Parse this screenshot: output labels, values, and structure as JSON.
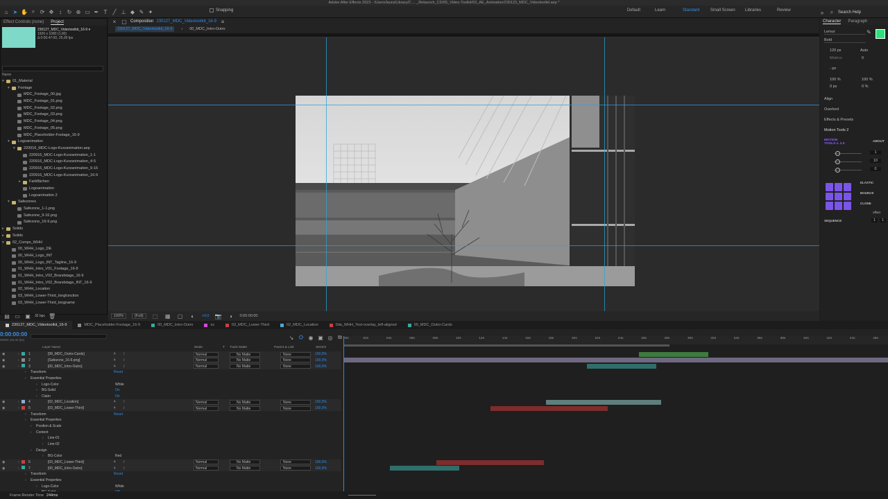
{
  "app": {
    "title": "Adobe After Effects 2023 - /Users/laura/Library/C ... _Relaunch_CD/05_Video-Toolkit/03_AE_Animation/230123_MDC_Videotoolkit.aep *"
  },
  "toolbar": {
    "snapping_label": "Snapping",
    "workspaces": [
      "Default",
      "Learn",
      "Standard",
      "Small Screen",
      "Libraries",
      "Review"
    ],
    "active_workspace": "Standard",
    "search_label": "Search Help"
  },
  "project": {
    "tabs": [
      "Effect Controls (none)",
      "Project"
    ],
    "active_tab": "Project",
    "selected_name": "230127_MDC_Videotoolkit_16-9 ▾",
    "selected_info1": "1920 x 1080 (1,00)",
    "selected_info2": "Δ 0:00:47:00, 25,00 fps",
    "column_name": "Name",
    "items": [
      {
        "label": "01_Material",
        "type": "folder",
        "indent": 0,
        "arrow": "▾"
      },
      {
        "label": "Footage",
        "type": "folder",
        "indent": 1,
        "arrow": "▾"
      },
      {
        "label": "MDC_Footage_00.jpg",
        "type": "file",
        "indent": 2,
        "arrow": ""
      },
      {
        "label": "MDC_Footage_01.png",
        "type": "file",
        "indent": 2,
        "arrow": ""
      },
      {
        "label": "MDC_Footage_02.png",
        "type": "file",
        "indent": 2,
        "arrow": ""
      },
      {
        "label": "MDC_Footage_03.png",
        "type": "file",
        "indent": 2,
        "arrow": ""
      },
      {
        "label": "MDC_Footage_04.png",
        "type": "file",
        "indent": 2,
        "arrow": ""
      },
      {
        "label": "MDC_Footage_05.png",
        "type": "file",
        "indent": 2,
        "arrow": ""
      },
      {
        "label": "MDC_Placeholder-Footage_16-9",
        "type": "comp",
        "indent": 2,
        "arrow": ""
      },
      {
        "label": "Logoanimation",
        "type": "folder",
        "indent": 1,
        "arrow": "▾"
      },
      {
        "label": "220916_MDC-Logo-Kurzanimation.aep",
        "type": "folder",
        "indent": 2,
        "arrow": "▾"
      },
      {
        "label": "220916_MDC-Logo-Kurzanimation_1-1",
        "type": "comp",
        "indent": 3,
        "arrow": ""
      },
      {
        "label": "220916_MDC-Logo-Kurzanimation_4-5",
        "type": "comp",
        "indent": 3,
        "arrow": ""
      },
      {
        "label": "220916_MDC-Logo-Kurzanimation_9-16",
        "type": "comp",
        "indent": 3,
        "arrow": ""
      },
      {
        "label": "220916_MDC-Logo-Kurzanimation_16-9",
        "type": "comp",
        "indent": 3,
        "arrow": ""
      },
      {
        "label": "Farbflächen",
        "type": "folder",
        "indent": 3,
        "arrow": "▸"
      },
      {
        "label": "Logoanimation",
        "type": "comp",
        "indent": 3,
        "arrow": ""
      },
      {
        "label": "Logoanimation 2",
        "type": "comp",
        "indent": 3,
        "arrow": ""
      },
      {
        "label": "Safezones",
        "type": "folder",
        "indent": 1,
        "arrow": "▾"
      },
      {
        "label": "Safezone_1-1.png",
        "type": "file",
        "indent": 2,
        "arrow": ""
      },
      {
        "label": "Safezone_9-16.png",
        "type": "file",
        "indent": 2,
        "arrow": ""
      },
      {
        "label": "Safezone_16-9.png",
        "type": "file",
        "indent": 2,
        "arrow": ""
      },
      {
        "label": "Solids",
        "type": "folder",
        "indent": 0,
        "arrow": "▸"
      },
      {
        "label": "Solids",
        "type": "folder",
        "indent": 0,
        "arrow": "▸"
      },
      {
        "label": "02_Comps_WHH",
        "type": "folder",
        "indent": 0,
        "arrow": "▾"
      },
      {
        "label": "00_WHH_Logo_DE",
        "type": "comp",
        "indent": 1,
        "arrow": ""
      },
      {
        "label": "00_WHH_Logo_INT",
        "type": "comp",
        "indent": 1,
        "arrow": ""
      },
      {
        "label": "00_WHH_Logo_INT_Tagline_16-9",
        "type": "comp",
        "indent": 1,
        "arrow": ""
      },
      {
        "label": "01_WHH_Intro_V01_Footage_16-9",
        "type": "comp",
        "indent": 1,
        "arrow": ""
      },
      {
        "label": "01_WHH_Intro_V02_Brandstage_16-9",
        "type": "comp",
        "indent": 1,
        "arrow": ""
      },
      {
        "label": "01_WHH_Intro_V02_Brandstage_INT_16-9",
        "type": "comp",
        "indent": 1,
        "arrow": ""
      },
      {
        "label": "02_WHH_Location",
        "type": "comp",
        "indent": 1,
        "arrow": ""
      },
      {
        "label": "03_WHH_Lower-Third_longfunction",
        "type": "comp",
        "indent": 1,
        "arrow": ""
      },
      {
        "label": "03_WHH_Lower-Third_longname",
        "type": "comp",
        "indent": 1,
        "arrow": ""
      }
    ],
    "bpc_label": "32 bpc"
  },
  "viewer": {
    "comp_label": "Composition",
    "comp_name": "230127_MDC_Videotoolkit_16-9",
    "breadcrumbs": [
      "230127_MDC_Videotoolkit_16-9",
      "00_MDC_Intro-Outro"
    ],
    "zoom": "100%",
    "resolution": "(Full)",
    "exposure": "+0,0",
    "timecode": "0:00:00:00"
  },
  "character": {
    "tabs": [
      "Character",
      "Paragraph"
    ],
    "font": "Lemur",
    "style": "Bold",
    "size": "120 px",
    "leading": "Auto",
    "metrics": "Metrics",
    "tracking": "0",
    "stroke_unit": "- px",
    "vscale": "100 %",
    "hscale": "100 %",
    "baseline": "0 px",
    "tsume": "0 %",
    "fill_color": "#2ee07a",
    "sections": [
      "Align",
      "Overlord",
      "Effects & Presets",
      "Motion Tools 2"
    ],
    "motion_tools_badge": "MOTION TOOLS v. 2.0",
    "about": "ABOUT",
    "mt_values": [
      "1",
      "10",
      "0"
    ],
    "mt_labels": [
      "ELASTIC",
      "BOUNCE",
      "CLONE",
      "SEQUENCE"
    ],
    "offset_label": "offset",
    "seq_values": [
      "1",
      "1"
    ],
    "accent": "#7a55e8"
  },
  "timeline": {
    "tabs": [
      {
        "label": "230127_MDC_Videotoolkit_16-9",
        "color": "#cccccc"
      },
      {
        "label": "MDC_Placeholder-Footage_16-9",
        "color": "#8a8a8a"
      },
      {
        "label": "00_MDC_Intro-Outro",
        "color": "#3aa7a0"
      },
      {
        "label": "xx",
        "color": "#d24ad8"
      },
      {
        "label": "03_MDC_Lower-Third",
        "color": "#c94040"
      },
      {
        "label": "02_MDC_Location",
        "color": "#4ea6d8"
      },
      {
        "label": "0da_WHH_Text-overlay_left-aligned",
        "color": "#c94040"
      },
      {
        "label": "99_MDC_Outro-Cards",
        "color": "#3aa7a0"
      }
    ],
    "current_time": "0:00:00:00",
    "fps_info": "00000 (25.00 fps)",
    "headers": {
      "layer_name": "Layer Name",
      "mode": "Mode",
      "t": "T",
      "track_matte": "Track Matte",
      "parent": "Parent & Link",
      "stretch": "Stretch"
    },
    "ruler": [
      "00s",
      "02s",
      "04s",
      "06s",
      "08s",
      "10s",
      "12s",
      "14s",
      "16s",
      "18s",
      "20s",
      "22s",
      "24s",
      "26s",
      "28s",
      "30s",
      "32s",
      "34s",
      "36s",
      "38s",
      "40s",
      "42s",
      "44s",
      "46s"
    ],
    "rows": [
      {
        "kind": "layer",
        "num": "1",
        "name": "[99_MDC_Outro-Cards]",
        "color": "#3aa7a0",
        "mode": "Normal",
        "matte": "No Matte",
        "parent": "None",
        "stretch": "100,0%"
      },
      {
        "kind": "layer",
        "num": "2",
        "name": "[Safezone_16-9.png]",
        "color": "#8a8a8a",
        "mode": "Normal",
        "matte": "No Matte",
        "parent": "None",
        "stretch": "100,0%"
      },
      {
        "kind": "layer",
        "num": "3",
        "name": "[00_MDC_Intro-Outro]",
        "color": "#3aa7a0",
        "mode": "Normal",
        "matte": "No Matte",
        "parent": "None",
        "stretch": "100,0%"
      },
      {
        "kind": "prop",
        "label": "Transform",
        "indent": 44,
        "val": "Reset",
        "reset": true
      },
      {
        "kind": "prop",
        "label": "Essential Properties",
        "indent": 44,
        "val": ""
      },
      {
        "kind": "prop",
        "label": "Logo-Color",
        "indent": 60,
        "val": "White"
      },
      {
        "kind": "prop",
        "label": "BG-Solid",
        "indent": 60,
        "val": "On",
        "blue": true
      },
      {
        "kind": "prop",
        "label": "Claim",
        "indent": 60,
        "val": "On",
        "blue": true
      },
      {
        "kind": "layer",
        "num": "4",
        "name": "[02_MDC_Location]",
        "color": "#8ab0d0",
        "mode": "Normal",
        "matte": "No Matte",
        "parent": "None",
        "stretch": "100,0%"
      },
      {
        "kind": "layer",
        "num": "5",
        "name": "[03_MDC_Lower-Third]",
        "color": "#c94040",
        "mode": "Normal",
        "matte": "No Matte",
        "parent": "None",
        "stretch": "100,0%"
      },
      {
        "kind": "prop",
        "label": "Transform",
        "indent": 44,
        "val": "Reset",
        "reset": true
      },
      {
        "kind": "prop",
        "label": "Essential Properties",
        "indent": 44,
        "val": ""
      },
      {
        "kind": "prop",
        "label": "Position & Scale",
        "indent": 52,
        "val": ""
      },
      {
        "kind": "prop",
        "label": "Content",
        "indent": 52,
        "val": ""
      },
      {
        "kind": "prop",
        "label": "Line-01",
        "indent": 69,
        "val": ""
      },
      {
        "kind": "prop",
        "label": "Line-02",
        "indent": 69,
        "val": ""
      },
      {
        "kind": "prop",
        "label": "Design",
        "indent": 52,
        "val": ""
      },
      {
        "kind": "prop",
        "label": "BG-Color",
        "indent": 69,
        "val": "Red"
      },
      {
        "kind": "layer",
        "num": "6",
        "name": "[03_MDC_Lower-Third]",
        "color": "#c94040",
        "mode": "Normal",
        "matte": "No Matte",
        "parent": "None",
        "stretch": "100,0%"
      },
      {
        "kind": "layer",
        "num": "7",
        "name": "[00_MDC_Intro-Outro]",
        "color": "#3aa7a0",
        "mode": "Normal",
        "matte": "No Matte",
        "parent": "None",
        "stretch": "100,0%"
      },
      {
        "kind": "prop",
        "label": "Transform",
        "indent": 44,
        "val": "Reset",
        "reset": true
      },
      {
        "kind": "prop",
        "label": "Essential Properties",
        "indent": 44,
        "val": ""
      },
      {
        "kind": "prop",
        "label": "Logo-Color",
        "indent": 60,
        "val": "White"
      },
      {
        "kind": "prop",
        "label": "BG-Solid",
        "indent": 60,
        "val": "Off",
        "blue": true
      }
    ],
    "bars": [
      {
        "row": 0,
        "from": 25.5,
        "to": 31.5,
        "color": "#3f7a3f"
      },
      {
        "row": 1,
        "from": 0,
        "to": 47,
        "color": "#6e6880"
      },
      {
        "row": 2,
        "from": 21,
        "to": 27,
        "color": "#2f6e6a"
      },
      {
        "row": 8,
        "from": 17.5,
        "to": 27.4,
        "color": "#5f7f7d"
      },
      {
        "row": 9,
        "from": 12.7,
        "to": 22.8,
        "color": "#7e2c2c"
      },
      {
        "row": 18,
        "from": 8,
        "to": 17.3,
        "color": "#7e2c2c"
      },
      {
        "row": 19,
        "from": 4,
        "to": 10,
        "color": "#2f6e6a"
      }
    ],
    "footer_label": "Frame Render Time",
    "render_time": "244ms"
  }
}
